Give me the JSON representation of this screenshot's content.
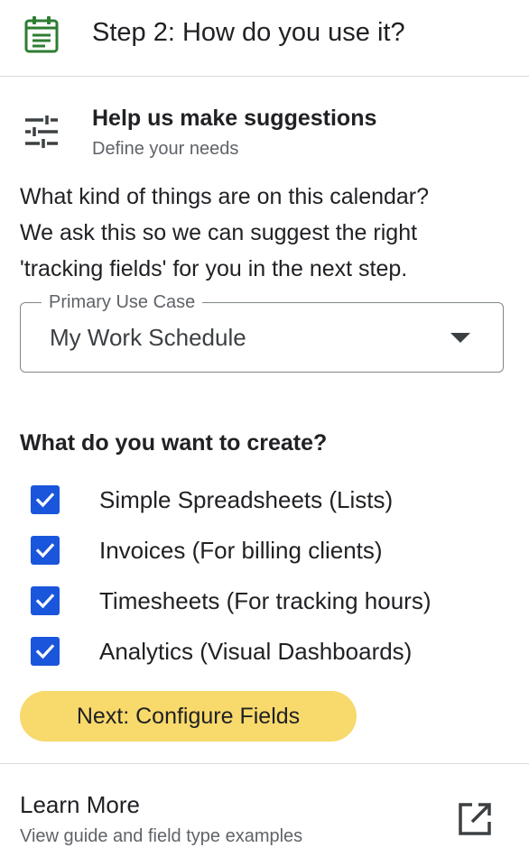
{
  "header": {
    "title": "Step 2: How do you use it?",
    "icon": "calendar-form-icon",
    "icon_color": "#2e7d32"
  },
  "suggestions": {
    "icon": "sliders-icon",
    "title": "Help us make suggestions",
    "subtitle": "Define your needs"
  },
  "description": {
    "lines": [
      "What kind of things are on this calendar?",
      "We ask this so we can suggest the right",
      "'tracking fields' for you in the next step."
    ]
  },
  "use_case_select": {
    "label": "Primary Use Case",
    "value": "My Work Schedule"
  },
  "create_section": {
    "heading": "What do you want to create?",
    "checkbox_color": "#1a56db",
    "options": [
      {
        "label": "Simple Spreadsheets (Lists)",
        "checked": true
      },
      {
        "label": "Invoices (For billing clients)",
        "checked": true
      },
      {
        "label": "Timesheets (For tracking hours)",
        "checked": true
      },
      {
        "label": "Analytics (Visual Dashboards)",
        "checked": true
      }
    ]
  },
  "next_button": {
    "label": "Next: Configure Fields",
    "color": "#f8d96b"
  },
  "learn_more": {
    "title": "Learn More",
    "subtitle": "View guide and field type examples",
    "icon": "open-in-new-icon"
  }
}
